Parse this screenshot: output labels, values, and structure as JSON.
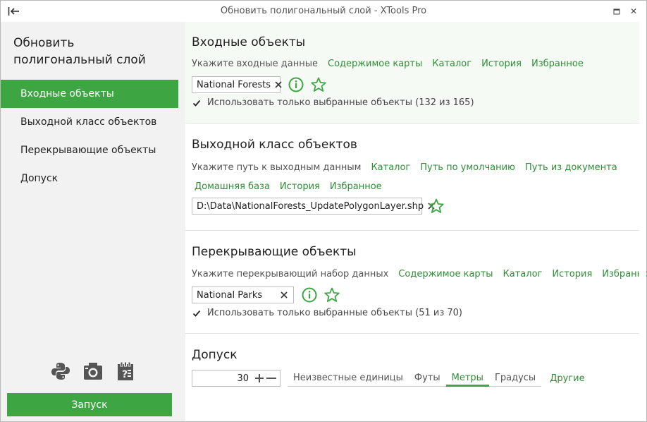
{
  "window": {
    "title": "Обновить полигональный слой - XTools Pro",
    "restore_glyph": "▫",
    "close_glyph": "✕"
  },
  "sidebar": {
    "title": "Обновить полигональный слой",
    "items": [
      {
        "label": "Входные объекты",
        "active": true
      },
      {
        "label": "Выходной класс объектов",
        "active": false
      },
      {
        "label": "Перекрывающие объекты",
        "active": false
      },
      {
        "label": "Допуск",
        "active": false
      }
    ],
    "tools": [
      "python-icon",
      "camera-icon",
      "help-doc-icon"
    ],
    "run_label": "Запуск"
  },
  "input": {
    "title": "Входные объекты",
    "prompt": "Укажите входные данные",
    "links": [
      "Содержимое карты",
      "Каталог",
      "История",
      "Избранное"
    ],
    "value": "National Forests",
    "checkbox_label": "Использовать только выбранные объекты (132 из 165)",
    "checked": true
  },
  "output": {
    "title": "Выходной класс объектов",
    "prompt": "Укажите путь к выходным данным",
    "links_row1": [
      "Каталог",
      "Путь по умолчанию",
      "Путь из документа"
    ],
    "links_row2": [
      "Домашняя база",
      "История",
      "Избранное"
    ],
    "value": "D:\\Data\\NationalForests_UpdatePolygonLayer.shp"
  },
  "overlay": {
    "title": "Перекрывающие объекты",
    "prompt": "Укажите перекрывающий набор данных",
    "links": [
      "Содержимое карты",
      "Каталог",
      "История",
      "Избранное"
    ],
    "value": "National Parks",
    "checkbox_label": "Использовать только выбранные объекты (51 из 70)",
    "checked": true
  },
  "tolerance": {
    "title": "Допуск",
    "value": "30",
    "units": [
      {
        "label": "Неизвестные единицы",
        "active": false
      },
      {
        "label": "Футы",
        "active": false
      },
      {
        "label": "Метры",
        "active": true
      },
      {
        "label": "Градусы",
        "active": false
      }
    ],
    "other_label": "Другие"
  },
  "colors": {
    "accent": "#3da642",
    "link": "#2e8f35"
  }
}
